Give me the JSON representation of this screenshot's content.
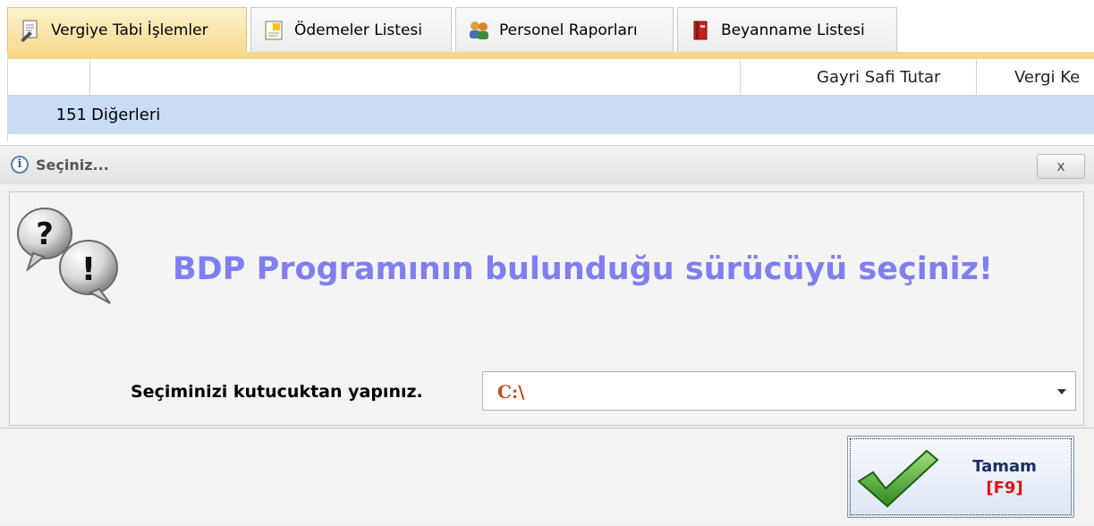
{
  "tabs": [
    {
      "label": "Vergiye Tabi İşlemler",
      "icon": "document-stamp-icon",
      "active": true
    },
    {
      "label": "Ödemeler Listesi",
      "icon": "note-icon",
      "active": false
    },
    {
      "label": "Personel Raporları",
      "icon": "people-icon",
      "active": false
    },
    {
      "label": "Beyanname Listesi",
      "icon": "red-book-icon",
      "active": false
    }
  ],
  "grid": {
    "columns": [
      "",
      "",
      "Gayri Safi Tutar",
      "Vergi Ke"
    ],
    "rows": [
      {
        "num": "151",
        "name": "Diğerleri"
      }
    ]
  },
  "dialog": {
    "title": "Seçiniz...",
    "close_label": "x",
    "message": "BDP Programının bulunduğu sürücüyü seçiniz!",
    "select_label": "Seçiminizi kutucuktan yapınız.",
    "select_value": "C:\\",
    "ok_label": "Tamam",
    "ok_key": "[F9]"
  },
  "colors": {
    "active_tab": "#f6dc8f",
    "row_highlight": "#c8dcf5",
    "message": "#7f7ff0",
    "combo_value": "#c0501f",
    "ok_key": "#e01010"
  }
}
